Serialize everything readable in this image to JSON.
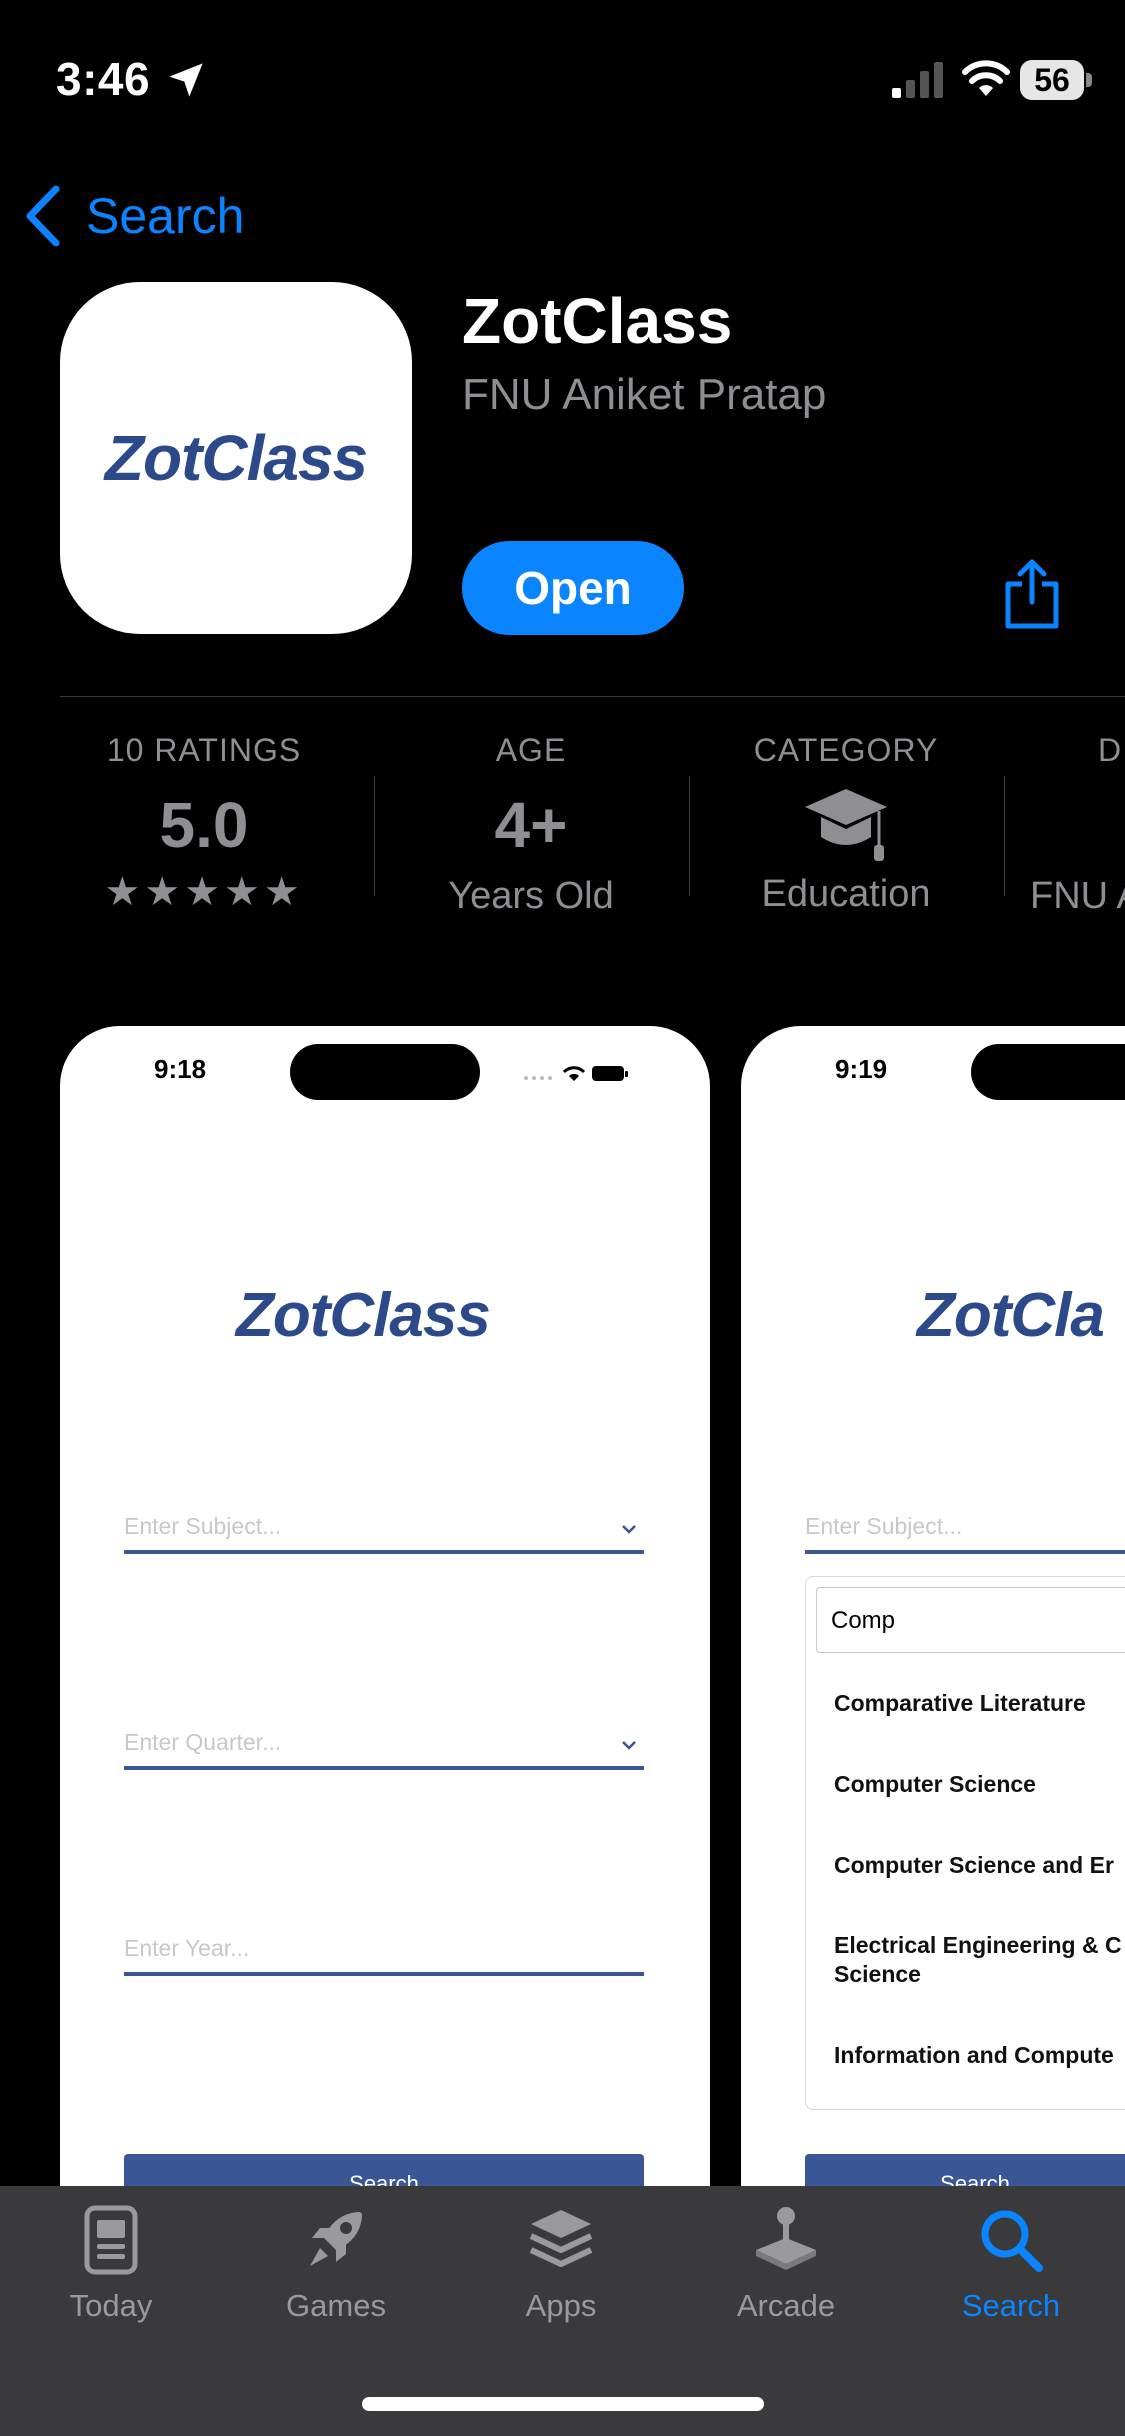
{
  "status_bar": {
    "time": "3:46",
    "battery": "56"
  },
  "nav": {
    "back_label": "Search"
  },
  "app": {
    "icon_text": "ZotClass",
    "title": "ZotClass",
    "developer": "FNU Aniket Pratap",
    "open_label": "Open"
  },
  "info": [
    {
      "label": "10 RATINGS",
      "value": "5.0",
      "sub": "★★★★★"
    },
    {
      "label": "AGE",
      "value": "4+",
      "sub": "Years Old"
    },
    {
      "label": "CATEGORY",
      "icon": "graduation-cap-icon",
      "sub": "Education"
    },
    {
      "label": "D",
      "sub": "FNU A"
    }
  ],
  "screenshots": [
    {
      "time": "9:18",
      "logo": "ZotClass",
      "subject_placeholder": "Enter Subject...",
      "quarter_placeholder": "Enter Quarter...",
      "year_placeholder": "Enter Year...",
      "button": "Search"
    },
    {
      "time": "9:19",
      "logo": "ZotCla",
      "subject_placeholder": "Enter Subject...",
      "search_value": "Comp",
      "options": [
        "Comparative Literature",
        "Computer Science",
        "Computer Science and Er",
        "Electrical Engineering & C",
        "Science",
        "Information and Compute"
      ],
      "button": "Search"
    }
  ],
  "tabs": [
    {
      "label": "Today",
      "icon": "today-icon"
    },
    {
      "label": "Games",
      "icon": "rocket-icon"
    },
    {
      "label": "Apps",
      "icon": "apps-stack-icon"
    },
    {
      "label": "Arcade",
      "icon": "joystick-icon"
    },
    {
      "label": "Search",
      "icon": "search-icon",
      "active": true
    }
  ],
  "colors": {
    "accent": "#0a84ff",
    "brand": "#2c4a8a",
    "field_line": "#3b5694"
  }
}
